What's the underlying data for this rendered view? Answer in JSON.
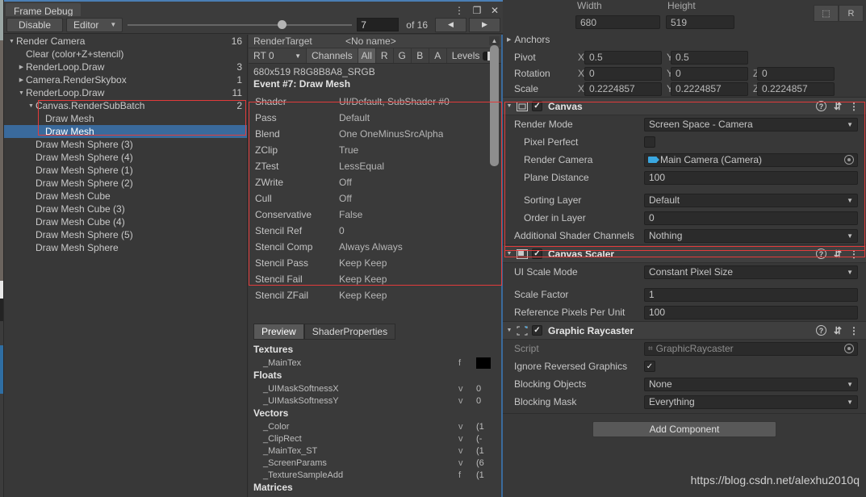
{
  "frame_debug": {
    "tab_title": "Frame Debug",
    "window_buttons": {
      "menu": "⋮",
      "maximize": "❐",
      "close": "✕"
    },
    "toolbar": {
      "disable_label": "Disable",
      "target_dropdown": "Editor",
      "caret": "▼",
      "event_index": "7",
      "event_total": "of 16",
      "prev_arrow": "◀",
      "next_arrow": "▶"
    },
    "tree": [
      {
        "label": "Render Camera",
        "indent": 0,
        "twisty": "down",
        "count": "16",
        "selected": false
      },
      {
        "label": "Clear (color+Z+stencil)",
        "indent": 1,
        "twisty": "none",
        "count": "",
        "selected": false
      },
      {
        "label": "RenderLoop.Draw",
        "indent": 1,
        "twisty": "right",
        "count": "3",
        "selected": false
      },
      {
        "label": "Camera.RenderSkybox",
        "indent": 1,
        "twisty": "right",
        "count": "1",
        "selected": false
      },
      {
        "label": "RenderLoop.Draw",
        "indent": 1,
        "twisty": "down",
        "count": "11",
        "selected": false
      },
      {
        "label": "Canvas.RenderSubBatch",
        "indent": 2,
        "twisty": "down",
        "count": "2",
        "selected": false
      },
      {
        "label": "Draw Mesh",
        "indent": 3,
        "twisty": "none",
        "count": "",
        "selected": false
      },
      {
        "label": "Draw Mesh",
        "indent": 3,
        "twisty": "none",
        "count": "",
        "selected": true
      },
      {
        "label": "Draw Mesh Sphere (3)",
        "indent": 2,
        "twisty": "none",
        "count": "",
        "selected": false
      },
      {
        "label": "Draw Mesh Sphere (4)",
        "indent": 2,
        "twisty": "none",
        "count": "",
        "selected": false
      },
      {
        "label": "Draw Mesh Sphere (1)",
        "indent": 2,
        "twisty": "none",
        "count": "",
        "selected": false
      },
      {
        "label": "Draw Mesh Sphere (2)",
        "indent": 2,
        "twisty": "none",
        "count": "",
        "selected": false
      },
      {
        "label": "Draw Mesh Cube",
        "indent": 2,
        "twisty": "none",
        "count": "",
        "selected": false
      },
      {
        "label": "Draw Mesh Cube (3)",
        "indent": 2,
        "twisty": "none",
        "count": "",
        "selected": false
      },
      {
        "label": "Draw Mesh Cube (4)",
        "indent": 2,
        "twisty": "none",
        "count": "",
        "selected": false
      },
      {
        "label": "Draw Mesh Sphere (5)",
        "indent": 2,
        "twisty": "none",
        "count": "",
        "selected": false
      },
      {
        "label": "Draw Mesh Sphere",
        "indent": 2,
        "twisty": "none",
        "count": "",
        "selected": false
      }
    ],
    "detail": {
      "rendertarget_label": "RenderTarget",
      "rendertarget_name": "<No name>",
      "rt_select": "RT 0",
      "channels_label": "Channels",
      "channels": [
        "All",
        "R",
        "G",
        "B",
        "A"
      ],
      "channel_active": "All",
      "levels_label": "Levels",
      "format_line": "680x519 R8G8B8A8_SRGB",
      "event_line": "Event #7: Draw Mesh",
      "properties": [
        {
          "key": "Shader",
          "value": "UI/Default, SubShader #0"
        },
        {
          "key": "Pass",
          "value": "Default"
        },
        {
          "key": "Blend",
          "value": "One OneMinusSrcAlpha"
        },
        {
          "key": "ZClip",
          "value": "True"
        },
        {
          "key": "ZTest",
          "value": "LessEqual"
        },
        {
          "key": "ZWrite",
          "value": "Off"
        },
        {
          "key": "Cull",
          "value": "Off"
        },
        {
          "key": "Conservative",
          "value": "False"
        },
        {
          "key": "Stencil Ref",
          "value": "0"
        },
        {
          "key": "Stencil Comp",
          "value": "Always Always"
        },
        {
          "key": "Stencil Pass",
          "value": "Keep Keep"
        },
        {
          "key": "Stencil Fail",
          "value": "Keep Keep"
        },
        {
          "key": "Stencil ZFail",
          "value": "Keep Keep"
        }
      ],
      "tabs": [
        {
          "label": "Preview",
          "active": true
        },
        {
          "label": "ShaderProperties",
          "active": false
        }
      ],
      "shader_properties": [
        {
          "group": "Textures"
        },
        {
          "name": "_MainTex",
          "type": "f",
          "value": "",
          "swatch": true
        },
        {
          "group": "Floats"
        },
        {
          "name": "_UIMaskSoftnessX",
          "type": "v",
          "value": "0"
        },
        {
          "name": "_UIMaskSoftnessY",
          "type": "v",
          "value": "0"
        },
        {
          "group": "Vectors"
        },
        {
          "name": "_Color",
          "type": "v",
          "value": "(1"
        },
        {
          "name": "_ClipRect",
          "type": "v",
          "value": "(-"
        },
        {
          "name": "_MainTex_ST",
          "type": "v",
          "value": "(1"
        },
        {
          "name": "_ScreenParams",
          "type": "v",
          "value": "(6"
        },
        {
          "name": "_TextureSampleAdd",
          "type": "f",
          "value": "(1"
        },
        {
          "group": "Matrices"
        }
      ]
    }
  },
  "inspector": {
    "rect": {
      "width_label": "Width",
      "height_label": "Height",
      "width_value": "680",
      "height_value": "519",
      "anchors_label": "Anchors",
      "pivot_label": "Pivot",
      "pivot_x": "0.5",
      "pivot_y": "0.5",
      "rotation_label": "Rotation",
      "rotation_x": "0",
      "rotation_y": "0",
      "rotation_z": "0",
      "scale_label": "Scale",
      "scale_x": "0.2224857",
      "scale_y": "0.2224857",
      "scale_z": "0.2224857",
      "blueprint_btn": "⬚",
      "raw_btn": "R",
      "axis_x": "X",
      "axis_y": "Y",
      "axis_z": "Z"
    },
    "components": [
      {
        "name": "Canvas",
        "icon": "canvas-icon",
        "enabled": true,
        "fields": [
          {
            "label": "Render Mode",
            "type": "dropdown",
            "value": "Screen Space - Camera",
            "indent": 0
          },
          {
            "label": "Pixel Perfect",
            "type": "checkbox",
            "value": "",
            "indent": 1,
            "checked": false
          },
          {
            "label": "Render Camera",
            "type": "object",
            "value": "Main Camera (Camera)",
            "indent": 1
          },
          {
            "label": "Plane Distance",
            "type": "text",
            "value": "100",
            "indent": 1
          },
          {
            "label": "Sorting Layer",
            "type": "dropdown",
            "value": "Default",
            "indent": 1,
            "gap": true
          },
          {
            "label": "Order in Layer",
            "type": "text",
            "value": "0",
            "indent": 1
          },
          {
            "label": "Additional Shader Channels",
            "type": "dropdown",
            "value": "Nothing",
            "indent": 0
          }
        ]
      },
      {
        "name": "Canvas Scaler",
        "icon": "canvas-scaler-icon",
        "enabled": true,
        "fields": [
          {
            "label": "UI Scale Mode",
            "type": "dropdown",
            "value": "Constant Pixel Size",
            "indent": 0
          },
          {
            "label": "Scale Factor",
            "type": "text",
            "value": "1",
            "indent": 0,
            "gap": true
          },
          {
            "label": "Reference Pixels Per Unit",
            "type": "text",
            "value": "100",
            "indent": 0
          }
        ]
      },
      {
        "name": "Graphic Raycaster",
        "icon": "graphic-raycaster-icon",
        "enabled": true,
        "fields": [
          {
            "label": "Script",
            "type": "script",
            "value": "GraphicRaycaster",
            "indent": 0,
            "disabled": true
          },
          {
            "label": "Ignore Reversed Graphics",
            "type": "checkbox",
            "value": "",
            "indent": 0,
            "checked": true
          },
          {
            "label": "Blocking Objects",
            "type": "dropdown",
            "value": "None",
            "indent": 0
          },
          {
            "label": "Blocking Mask",
            "type": "dropdown",
            "value": "Everything",
            "indent": 0
          }
        ]
      }
    ],
    "add_component_label": "Add Component",
    "watermark": "https://blog.csdn.net/alexhu2010q"
  },
  "colors": {
    "selection_blue": "#3a6a9c",
    "highlight_red": "#e23b3b",
    "accent_top": "#4a7fb5",
    "panel_bg": "#383838"
  }
}
